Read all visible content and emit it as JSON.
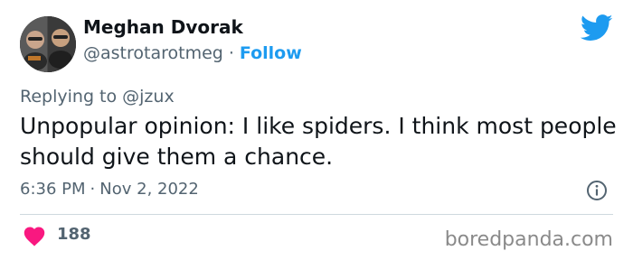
{
  "author": {
    "name": "Meghan Dvorak",
    "handle": "@astrotarotmeg",
    "separator": "·",
    "follow_label": "Follow"
  },
  "reply": {
    "label": "Replying to @jzux"
  },
  "tweet": {
    "text": "Unpopular opinion: I like spiders. I think most people should give them a chance."
  },
  "meta": {
    "time": "6:36 PM",
    "separator": "·",
    "date": "Nov 2, 2022"
  },
  "engagement": {
    "likes": "188"
  },
  "icons": {
    "logo": "twitter-bird-icon",
    "info": "info-icon",
    "like": "heart-icon"
  },
  "colors": {
    "accent": "#1d9bf0",
    "like": "#f91880",
    "secondary_text": "#536471",
    "primary_text": "#0f1419",
    "divider": "#cfd9de"
  },
  "watermark": {
    "text": "boredpanda.com"
  }
}
